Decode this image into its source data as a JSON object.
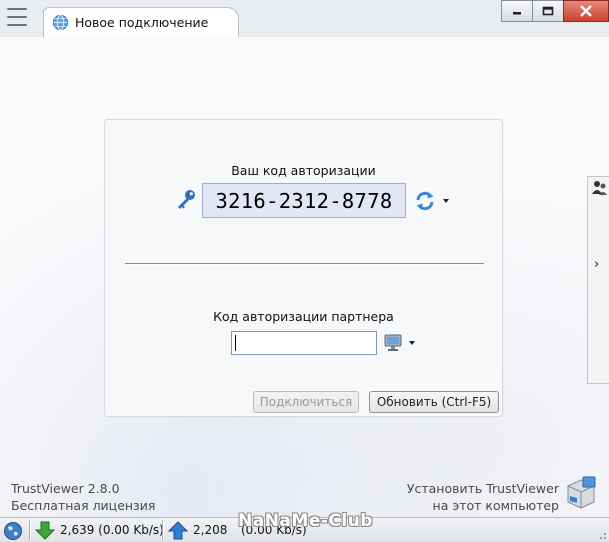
{
  "window": {
    "tab_title": "Новое подключение"
  },
  "own_code": {
    "title": "Ваш код авторизации",
    "code": "3216-2312-8778"
  },
  "partner": {
    "title": "Код авторизации партнера",
    "value": ""
  },
  "buttons": {
    "connect": "Подключиться",
    "refresh": "Обновить (Ctrl-F5)"
  },
  "footer": {
    "app_name": "TrustViewer 2.8.0",
    "license": "Бесплатная лицензия",
    "install_line1": "Установить TrustViewer",
    "install_line2": "на этот компьютер"
  },
  "status": {
    "download": "2,639 (0.00 Kb/s)",
    "upload_count": "2,208",
    "upload_speed": "(0.00 Kb/s)"
  },
  "watermark": "NaNaMe-Club",
  "colors": {
    "code_background": "#e4e6f6",
    "close_button": "#c8412c",
    "download_arrow": "#3aa63a",
    "upload_arrow": "#2d7fd6"
  },
  "icons": {
    "menu": "hamburger-icon",
    "tab": "globe-icon",
    "key": "key-icon",
    "refresh": "refresh-icon",
    "partner": "computer-icon",
    "side": "people-icon",
    "install": "install-box-icon"
  }
}
